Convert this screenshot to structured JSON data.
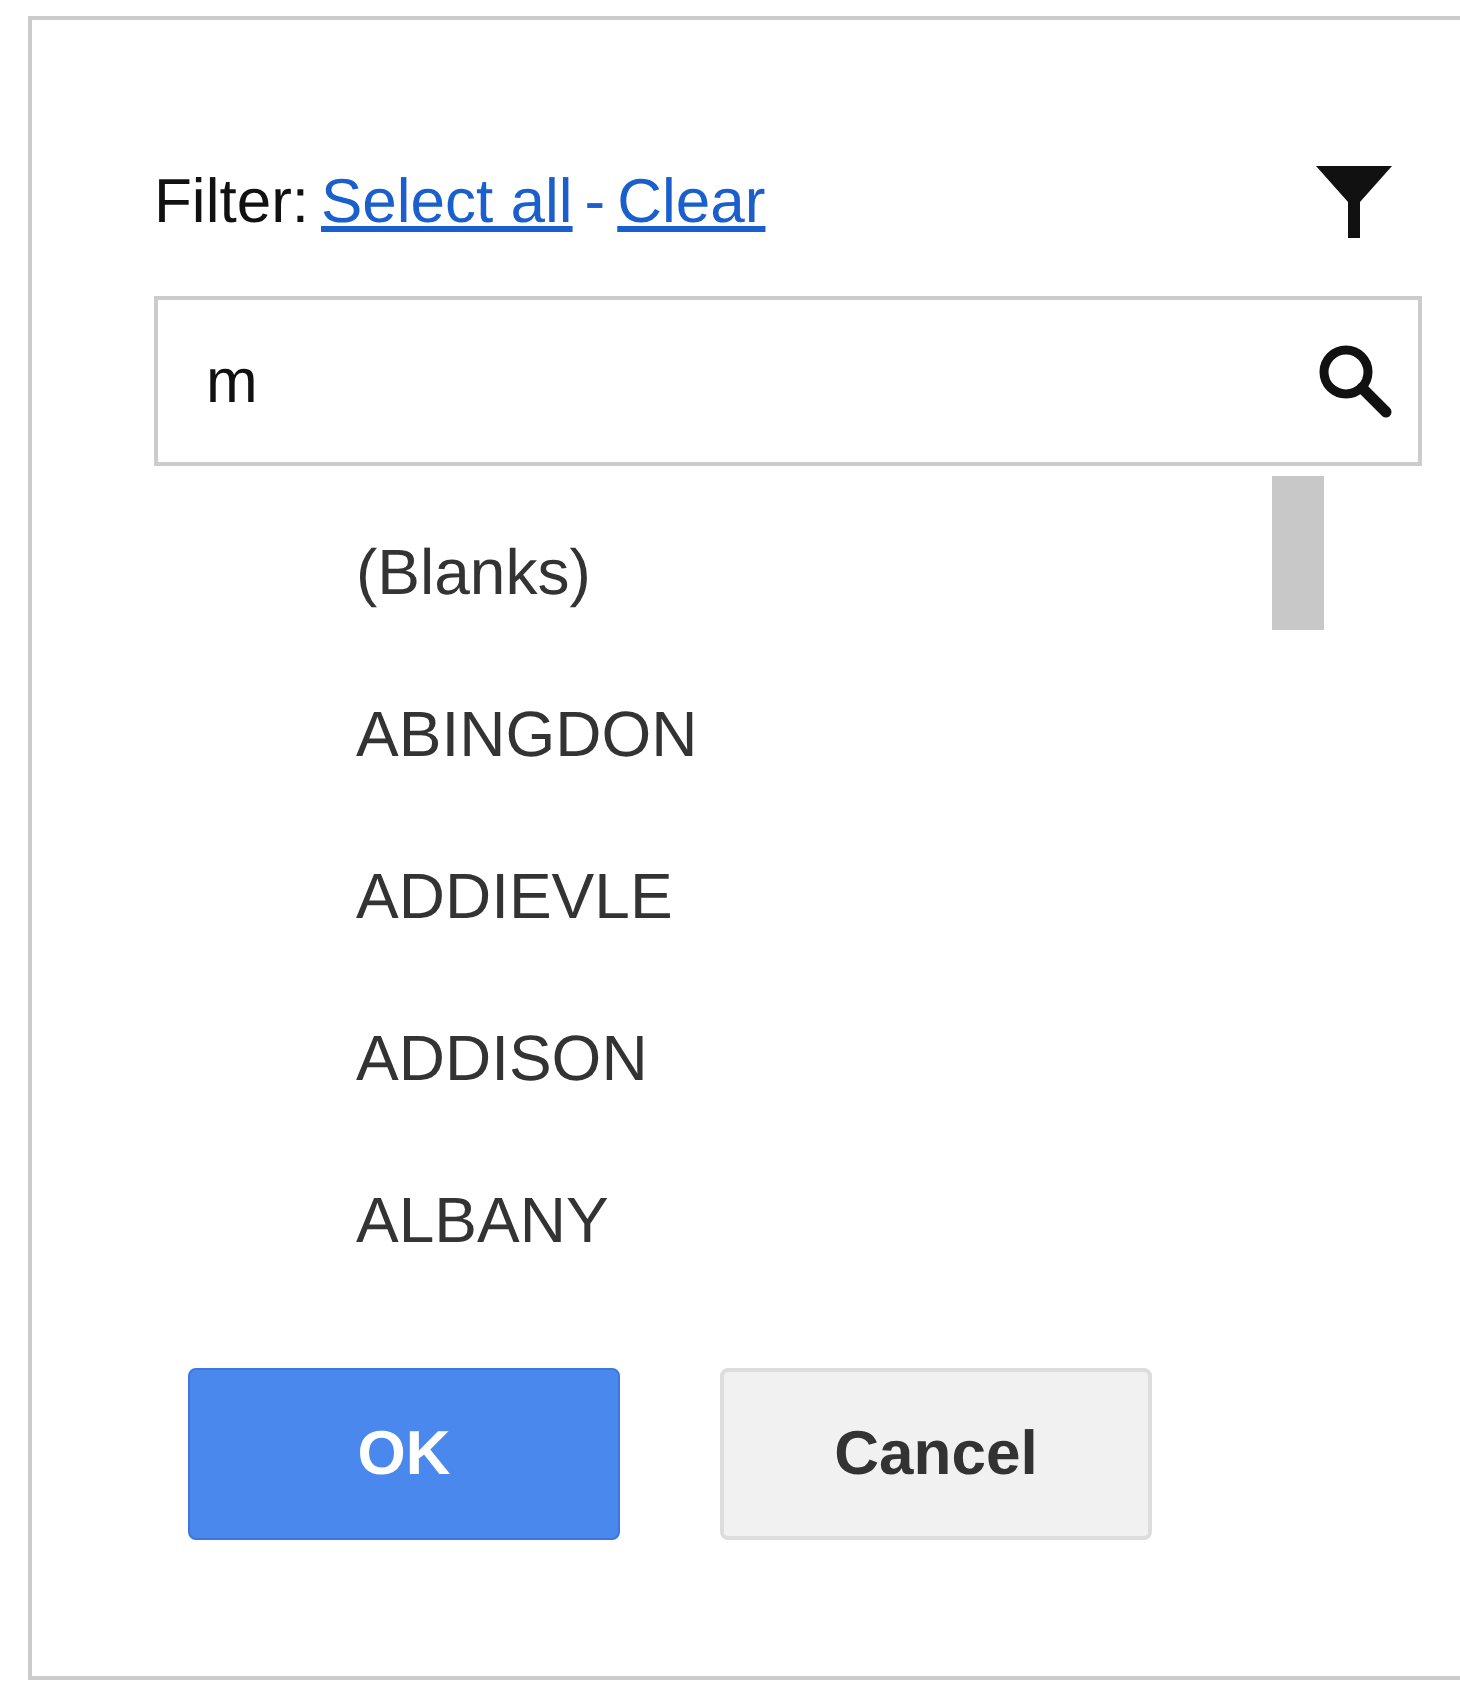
{
  "filter": {
    "label": "Filter:",
    "links": [
      "Select all",
      "Clear"
    ],
    "separator": "-"
  },
  "search": {
    "value": "m"
  },
  "items": [
    "(Blanks)",
    "ABINGDON",
    "ADDIEVLE",
    "ADDISON",
    "ALBANY"
  ],
  "buttons": [
    {
      "label": "OK",
      "kind": "primary"
    },
    {
      "label": "Cancel",
      "kind": "secondary"
    }
  ]
}
